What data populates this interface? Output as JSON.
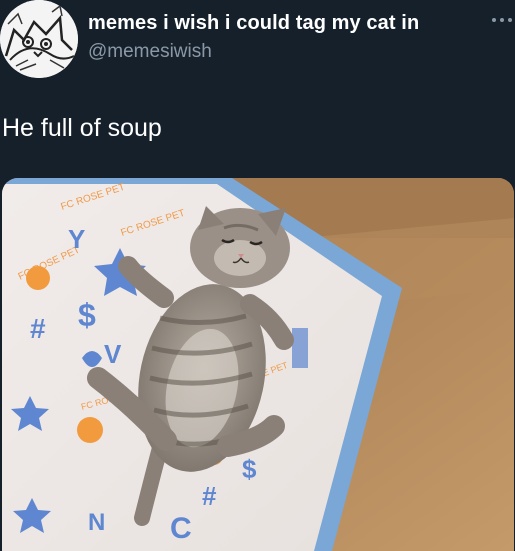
{
  "tweet": {
    "display_name": "memes i wish i could tag my cat in",
    "handle": "@memesiwish",
    "text": "He full of soup",
    "more_icon": "more-horizontal-icon",
    "avatar_icon": "cat-drawing-avatar",
    "media": {
      "type": "photo",
      "printed_text": [
        "FC ROSE PET",
        "FC ROSE PET",
        "#",
        "$",
        "C",
        "N"
      ]
    }
  },
  "colors": {
    "background": "#15202b",
    "primary_text": "#ffffff",
    "secondary_text": "#8b98a5"
  }
}
